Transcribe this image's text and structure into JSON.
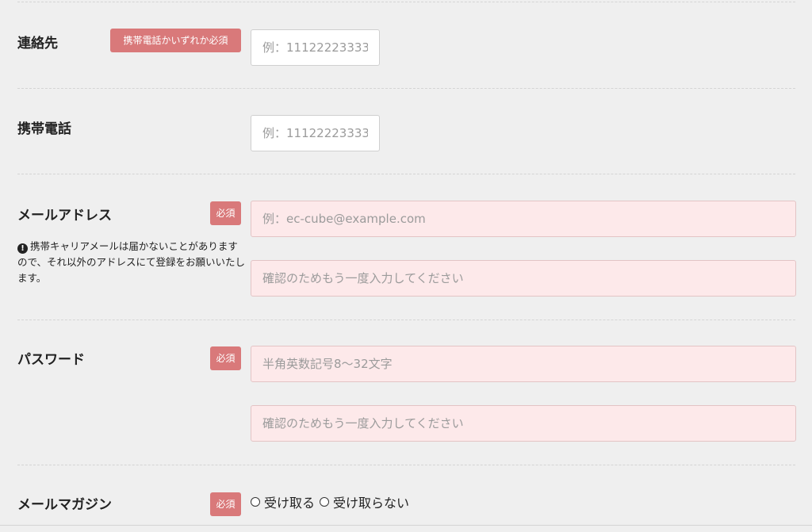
{
  "contact": {
    "label": "連絡先",
    "badge": "携帯電話かいずれか必須",
    "placeholder": "例：11122223333"
  },
  "mobile": {
    "label": "携帯電話",
    "placeholder": "例：11122223333"
  },
  "email": {
    "label": "メールアドレス",
    "badge": "必須",
    "note_icon": "!",
    "note": "携帯キャリアメールは届かないことがありますので、それ以外のアドレスにて登録をお願いいたします。",
    "placeholder": "例：ec-cube@example.com",
    "confirm_placeholder": "確認のためもう一度入力してください"
  },
  "password": {
    "label": "パスワード",
    "badge": "必須",
    "placeholder": "半角英数記号8〜32文字",
    "confirm_placeholder": "確認のためもう一度入力してください"
  },
  "magazine": {
    "label": "メールマガジン",
    "badge": "必須",
    "options": [
      "受け取る",
      "受け取らない"
    ]
  }
}
